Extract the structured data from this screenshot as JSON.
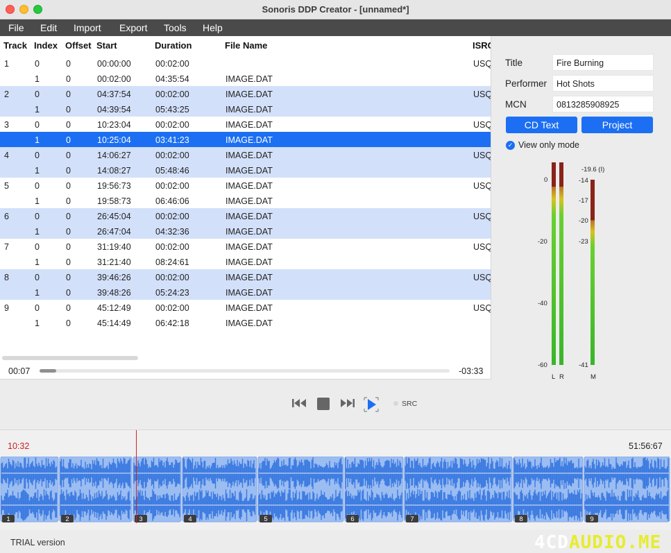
{
  "window": {
    "title": "Sonoris DDP Creator - [unnamed*]"
  },
  "menu": [
    "File",
    "Edit",
    "Import",
    "Export",
    "Tools",
    "Help"
  ],
  "table": {
    "columns": [
      "Track",
      "Index",
      "Offset",
      "Start",
      "Duration",
      "File Name",
      "ISRC"
    ],
    "rows": [
      {
        "track": "1",
        "index": "0",
        "offset": "0",
        "start": "00:00:00",
        "duration": "00:02:00",
        "file": "",
        "isrc": "USQ",
        "style": ""
      },
      {
        "track": "",
        "index": "1",
        "offset": "0",
        "start": "00:02:00",
        "duration": "04:35:54",
        "file": "IMAGE.DAT",
        "isrc": "",
        "style": ""
      },
      {
        "track": "2",
        "index": "0",
        "offset": "0",
        "start": "04:37:54",
        "duration": "00:02:00",
        "file": "IMAGE.DAT",
        "isrc": "USQ",
        "style": "alt"
      },
      {
        "track": "",
        "index": "1",
        "offset": "0",
        "start": "04:39:54",
        "duration": "05:43:25",
        "file": "IMAGE.DAT",
        "isrc": "",
        "style": "alt"
      },
      {
        "track": "3",
        "index": "0",
        "offset": "0",
        "start": "10:23:04",
        "duration": "00:02:00",
        "file": "IMAGE.DAT",
        "isrc": "USQ",
        "style": ""
      },
      {
        "track": "",
        "index": "1",
        "offset": "0",
        "start": "10:25:04",
        "duration": "03:41:23",
        "file": "IMAGE.DAT",
        "isrc": "",
        "style": "sel"
      },
      {
        "track": "4",
        "index": "0",
        "offset": "0",
        "start": "14:06:27",
        "duration": "00:02:00",
        "file": "IMAGE.DAT",
        "isrc": "USQ",
        "style": "alt"
      },
      {
        "track": "",
        "index": "1",
        "offset": "0",
        "start": "14:08:27",
        "duration": "05:48:46",
        "file": "IMAGE.DAT",
        "isrc": "",
        "style": "alt"
      },
      {
        "track": "5",
        "index": "0",
        "offset": "0",
        "start": "19:56:73",
        "duration": "00:02:00",
        "file": "IMAGE.DAT",
        "isrc": "USQ",
        "style": ""
      },
      {
        "track": "",
        "index": "1",
        "offset": "0",
        "start": "19:58:73",
        "duration": "06:46:06",
        "file": "IMAGE.DAT",
        "isrc": "",
        "style": ""
      },
      {
        "track": "6",
        "index": "0",
        "offset": "0",
        "start": "26:45:04",
        "duration": "00:02:00",
        "file": "IMAGE.DAT",
        "isrc": "USQ",
        "style": "alt"
      },
      {
        "track": "",
        "index": "1",
        "offset": "0",
        "start": "26:47:04",
        "duration": "04:32:36",
        "file": "IMAGE.DAT",
        "isrc": "",
        "style": "alt"
      },
      {
        "track": "7",
        "index": "0",
        "offset": "0",
        "start": "31:19:40",
        "duration": "00:02:00",
        "file": "IMAGE.DAT",
        "isrc": "USQ",
        "style": ""
      },
      {
        "track": "",
        "index": "1",
        "offset": "0",
        "start": "31:21:40",
        "duration": "08:24:61",
        "file": "IMAGE.DAT",
        "isrc": "",
        "style": ""
      },
      {
        "track": "8",
        "index": "0",
        "offset": "0",
        "start": "39:46:26",
        "duration": "00:02:00",
        "file": "IMAGE.DAT",
        "isrc": "USQ",
        "style": "alt"
      },
      {
        "track": "",
        "index": "1",
        "offset": "0",
        "start": "39:48:26",
        "duration": "05:24:23",
        "file": "IMAGE.DAT",
        "isrc": "",
        "style": "alt"
      },
      {
        "track": "9",
        "index": "0",
        "offset": "0",
        "start": "45:12:49",
        "duration": "00:02:00",
        "file": "IMAGE.DAT",
        "isrc": "USQ",
        "style": ""
      },
      {
        "track": "",
        "index": "1",
        "offset": "0",
        "start": "45:14:49",
        "duration": "06:42:18",
        "file": "IMAGE.DAT",
        "isrc": "",
        "style": ""
      }
    ]
  },
  "playback": {
    "elapsed": "00:07",
    "remaining": "-03:33",
    "progress_fraction": 0.04
  },
  "cdtext": {
    "title_label": "Title",
    "title_value": "Fire Burning",
    "performer_label": "Performer",
    "performer_value": "Hot Shots",
    "mcn_label": "MCN",
    "mcn_value": "0813285908925",
    "cd_text_button": "CD Text",
    "project_button": "Project",
    "view_only_label": "View only mode",
    "view_only_checked": true
  },
  "meters": {
    "lr_scale": [
      "0",
      "-20",
      "-40",
      "-60"
    ],
    "lr_labels": [
      "L",
      "R"
    ],
    "m_peak": "-19.6 (I)",
    "m_scale": [
      "-14",
      "-17",
      "-20",
      "-23",
      "-41"
    ],
    "m_label": "M",
    "left_level": 0.88,
    "right_level": 0.88,
    "m_level": 0.78
  },
  "transport": {
    "src_label": "SRC"
  },
  "waveform": {
    "cursor_time": "10:32",
    "total_time": "51:56:67",
    "tracks": [
      "1",
      "2",
      "3",
      "4",
      "5",
      "6",
      "7",
      "8",
      "9"
    ]
  },
  "status": {
    "trial": "TRIAL version",
    "watermark_a": "4CD",
    "watermark_b": "AUDIO.ME"
  },
  "colors": {
    "accent": "#1c6ff2",
    "alt_row": "#d3e0fa",
    "wave_fill": "#3a79e0",
    "wave_bg": "#9bbdf2",
    "cursor": "#d42020"
  }
}
